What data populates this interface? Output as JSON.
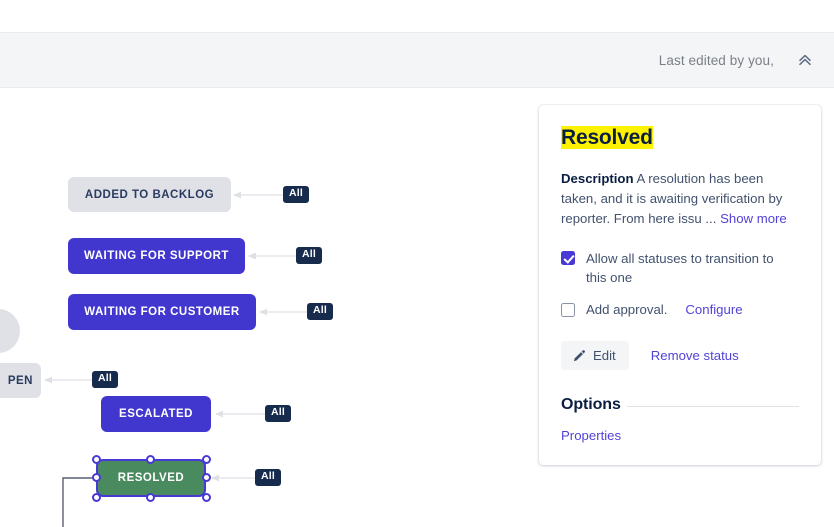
{
  "header": {
    "last_edited": "Last edited by you,",
    "collapse_icon": "chevron-double-up-icon"
  },
  "diagram": {
    "nodes": [
      {
        "id": "added-to-backlog",
        "label": "ADDED TO BACKLOG",
        "color": "grey",
        "selected": false
      },
      {
        "id": "waiting-for-support",
        "label": "WAITING FOR SUPPORT",
        "color": "blue",
        "selected": false
      },
      {
        "id": "waiting-for-customer",
        "label": "WAITING FOR CUSTOMER",
        "color": "blue",
        "selected": false
      },
      {
        "id": "open",
        "label": "PEN",
        "color": "grey",
        "selected": false
      },
      {
        "id": "escalated",
        "label": "ESCALATED",
        "color": "blue",
        "selected": false
      },
      {
        "id": "resolved",
        "label": "RESOLVED",
        "color": "green",
        "selected": true
      }
    ],
    "transition_badges": [
      {
        "id": "all-added-to-backlog",
        "label": "All"
      },
      {
        "id": "all-waiting-for-support",
        "label": "All"
      },
      {
        "id": "all-waiting-for-customer",
        "label": "All"
      },
      {
        "id": "all-open",
        "label": "All"
      },
      {
        "id": "all-escalated",
        "label": "All"
      },
      {
        "id": "all-resolved",
        "label": "All"
      }
    ],
    "colors": {
      "node_blue": "#4136cd",
      "node_green": "#4a8a5f",
      "node_grey": "#dfe1e6",
      "badge": "#172b4d",
      "selection": "#4839d4",
      "edge": "#dfe1e6"
    }
  },
  "panel": {
    "title": "Resolved",
    "title_highlight_color": "#fff200",
    "description_label": "Description",
    "description_text": "A resolution has been taken, and it is awaiting verification by reporter. From here issu",
    "description_ellipsis": "...",
    "show_more_label": "Show more",
    "allow_all_checkbox": {
      "label": "Allow all statuses to transition to this one",
      "checked": true
    },
    "add_approval_checkbox": {
      "label": "Add approval.",
      "checked": false
    },
    "configure_label": "Configure",
    "edit_button": {
      "label": "Edit",
      "icon": "pencil-icon"
    },
    "remove_status_label": "Remove status",
    "options_heading": "Options",
    "properties_label": "Properties"
  }
}
